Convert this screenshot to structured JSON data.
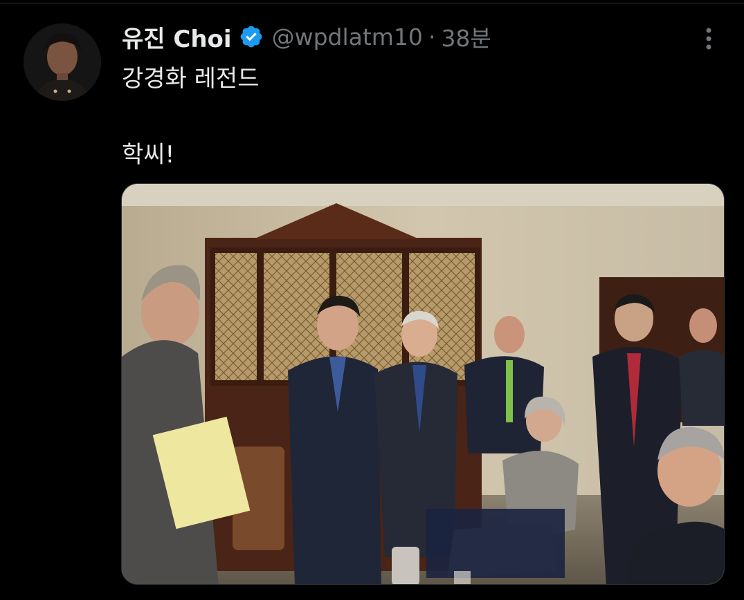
{
  "tweet": {
    "display_name": "유진 Choi",
    "handle": "@wpdlatm10",
    "separator": "·",
    "time": "38분",
    "text_line1": "강경화 레전드",
    "text_line2": "학씨!",
    "verified": true
  },
  "icons": {
    "verified": "verified-badge-icon",
    "more": "more-options-icon"
  },
  "colors": {
    "background": "#000000",
    "text_primary": "#e7e9ea",
    "text_secondary": "#71767b",
    "verified_blue": "#1d9bf0"
  }
}
